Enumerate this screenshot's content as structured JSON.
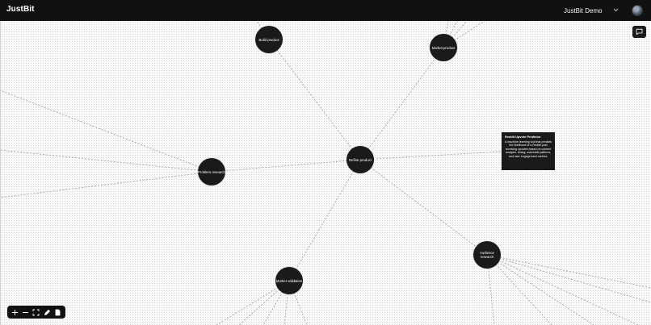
{
  "app": {
    "brand": "JustBit"
  },
  "header": {
    "project_selector": {
      "selected": "JustBit Demo"
    },
    "avatar_icon": "user-avatar-icon"
  },
  "canvas": {
    "nodes": {
      "define_product": "Define product",
      "build_product": "Build product",
      "market_product": "Market product",
      "problem_research": "Problem research",
      "audience_research": "Audience research",
      "market_validation": "Market validation"
    },
    "tooltip": {
      "title": "Reddit Upvote Predictor",
      "body": "A machine learning tool that predicts the likelihood of a Reddit post receiving upvotes based on content analysis, timing, subreddit patterns, and user engagement metrics."
    }
  },
  "colors": {
    "topbar": "#111111",
    "node": "#1a1a1a",
    "edge": "#9a9a9a",
    "canvas": "#fafafa"
  },
  "toolbar": {
    "tools": [
      "zoom-in-icon",
      "zoom-out-icon",
      "fit-view-icon",
      "edit-icon",
      "document-icon"
    ]
  },
  "chat_button": {
    "icon": "chat-icon"
  }
}
